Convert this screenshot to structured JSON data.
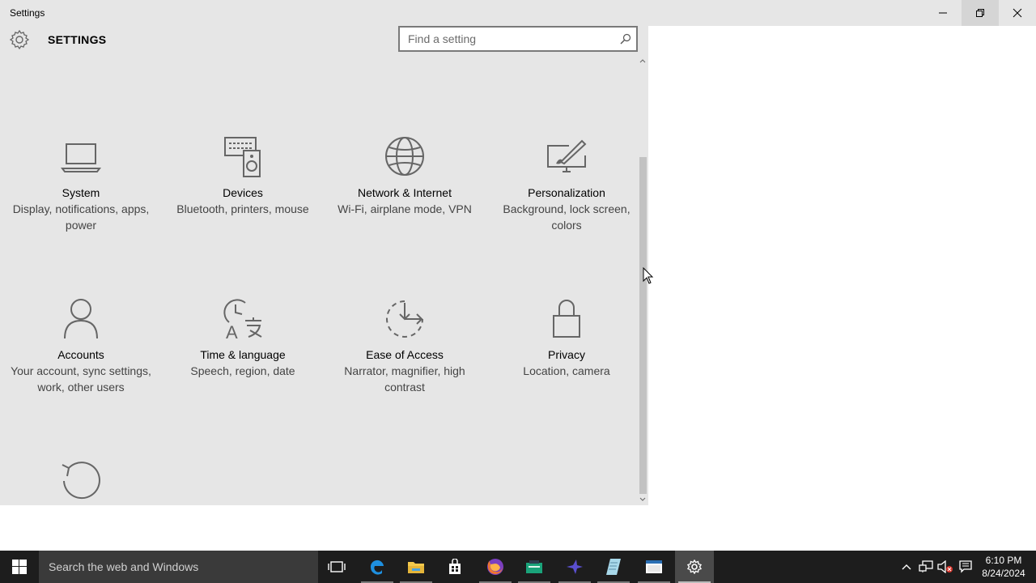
{
  "window": {
    "title": "Settings"
  },
  "header": {
    "title": "SETTINGS",
    "search_placeholder": "Find a setting"
  },
  "tiles": [
    {
      "name": "System",
      "desc": "Display, notifications, apps, power",
      "icon": "laptop-icon"
    },
    {
      "name": "Devices",
      "desc": "Bluetooth, printers, mouse",
      "icon": "devices-icon"
    },
    {
      "name": "Network & Internet",
      "desc": "Wi-Fi, airplane mode, VPN",
      "icon": "globe-icon"
    },
    {
      "name": "Personalization",
      "desc": "Background, lock screen, colors",
      "icon": "paint-icon"
    },
    {
      "name": "Accounts",
      "desc": "Your account, sync settings, work, other users",
      "icon": "person-icon"
    },
    {
      "name": "Time & language",
      "desc": "Speech, region, date",
      "icon": "clock-language-icon"
    },
    {
      "name": "Ease of Access",
      "desc": "Narrator, magnifier, high contrast",
      "icon": "ease-of-access-icon"
    },
    {
      "name": "Privacy",
      "desc": "Location, camera",
      "icon": "lock-icon"
    },
    {
      "name": "",
      "desc": "",
      "icon": "update-refresh-icon"
    }
  ],
  "taskbar": {
    "search_text": "Search the web and Windows",
    "time": "6:10 PM",
    "date": "8/24/2024",
    "apps": [
      "task-view-icon",
      "edge-icon",
      "file-explorer-icon",
      "store-icon",
      "firefox-icon",
      "app-icon",
      "bird-app-icon",
      "notepad-icon",
      "terminal-icon",
      "settings-gear-icon"
    ]
  },
  "colors": {
    "panel_bg": "#e6e6e6",
    "taskbar_bg": "#1d1d1d",
    "edge_blue": "#1e90e0",
    "folder_yellow": "#f2c94c"
  }
}
